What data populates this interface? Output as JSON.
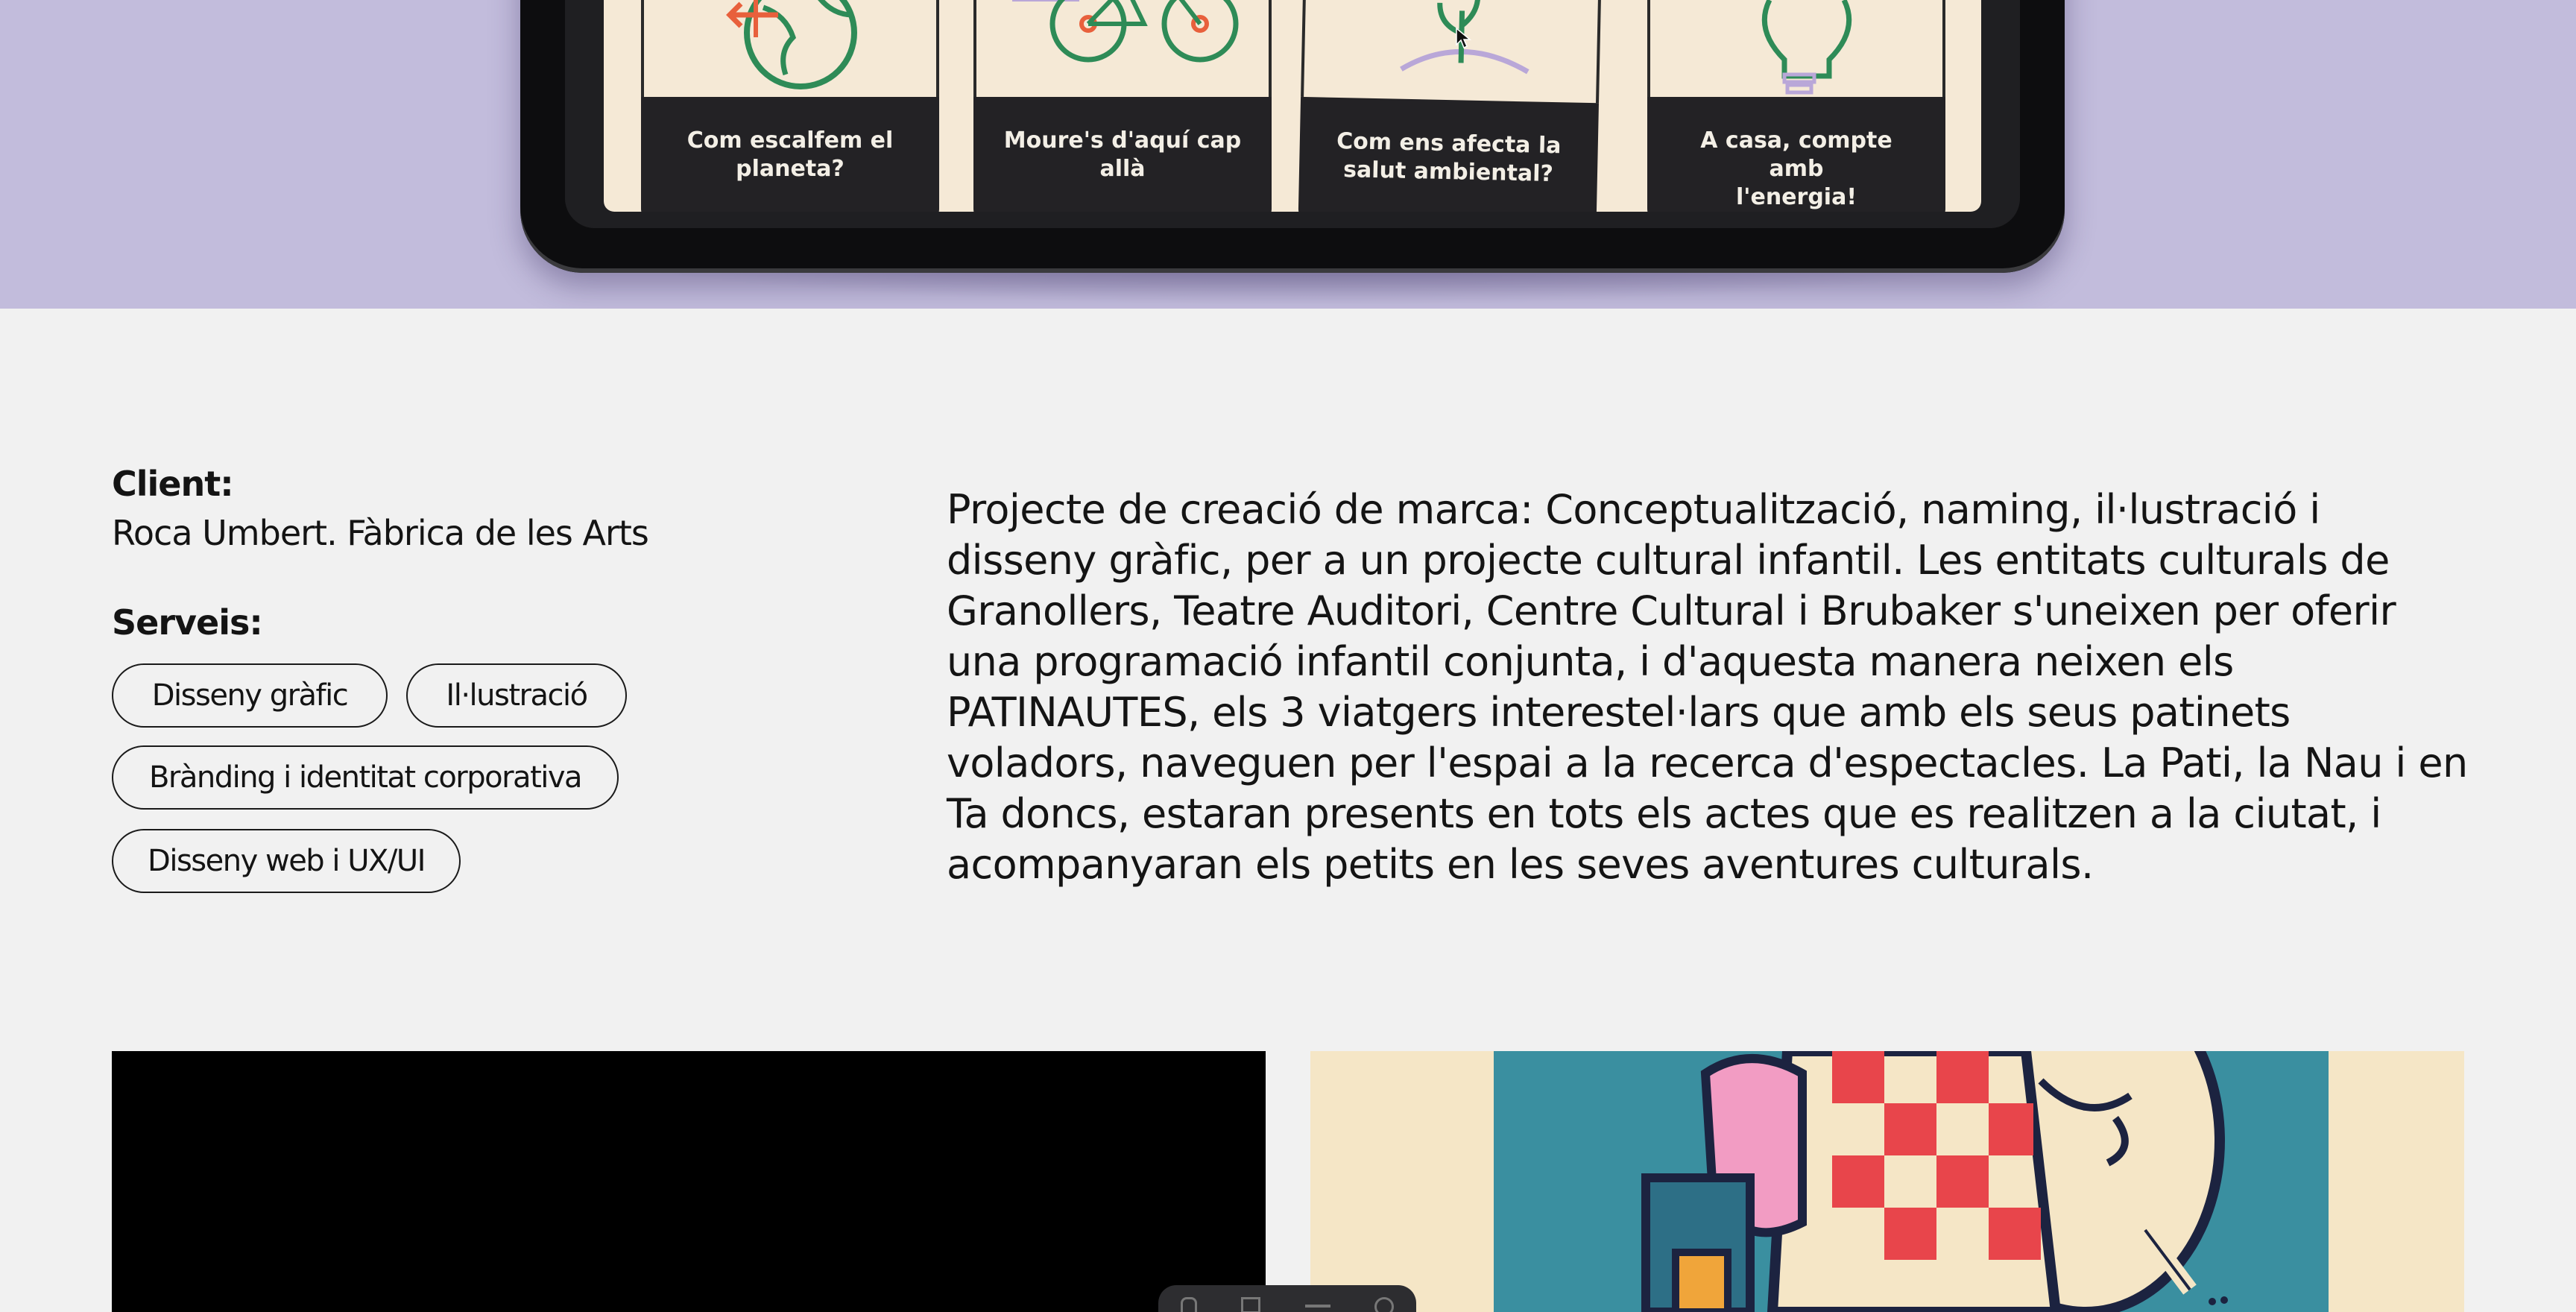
{
  "hero": {
    "cards": [
      {
        "caption_line1": "Com escalfem el",
        "caption_line2": "planeta?",
        "icon": "globe-thermometer-icon"
      },
      {
        "caption_line1": "Moure's d'aquí cap",
        "caption_line2": "allà",
        "icon": "bicycle-icon"
      },
      {
        "caption_line1": "Com ens afecta la",
        "caption_line2": "salut ambiental?",
        "icon": "sprout-icon"
      },
      {
        "caption_line1": "A casa, compte amb",
        "caption_line2": "l'energia!",
        "icon": "lightbulb-icon"
      }
    ],
    "colors": {
      "band": "#c2bcdc",
      "screen": "#f5e9d6",
      "caption_bg": "#232225",
      "green": "#2e8b57",
      "orange": "#e8603c",
      "lilac": "#b9a7d8"
    }
  },
  "info": {
    "client_label": "Client:",
    "client_value": "Roca Umbert. Fàbrica de les Arts",
    "services_label": "Serveis:",
    "services": [
      "Disseny gràfic",
      "Il·lustració",
      "Brànding i identitat corporativa",
      "Disseny web i UX/UI"
    ]
  },
  "description": {
    "text": "Projecte de creació de marca: Conceptualització, naming, il·lustració i disseny gràfic, per a un projecte cultural infantil. Les entitats culturals de Granollers, Teatre Auditori, Centre Cultural i Brubaker s'uneixen per oferir una programació infantil conjunta, i d'aquesta manera neixen els PATINAUTES, els 3 viatgers interestel·lars que amb els seus patinets voladors, naveguen per l'espai a la recerca d'espectacles. La Pati, la Nau i en Ta doncs, estaran presents en tots els actes que es realitzen a la ciutat, i acompanyaran els petits en les seves aventures culturals."
  },
  "media": {
    "video_controls_icons": [
      "hand-icon",
      "clapper-icon",
      "caption-icon",
      "settings-icon"
    ],
    "colors": {
      "video_bg": "#000000",
      "illustration_bg": "#f5e6c6",
      "teal": "#3a8fa0",
      "red": "#e8454b",
      "pink": "#f29cc3",
      "navy": "#1c2340"
    }
  }
}
